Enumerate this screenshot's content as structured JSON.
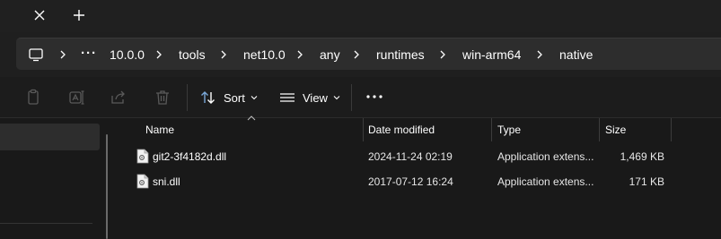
{
  "tabs": {
    "close_glyph": "✕",
    "new_glyph": "+"
  },
  "address": {
    "more_label": "···",
    "breadcrumbs": [
      "10.0.0",
      "tools",
      "net10.0",
      "any",
      "runtimes",
      "win-arm64",
      "native"
    ]
  },
  "toolbar": {
    "sort_label": "Sort",
    "view_label": "View",
    "icons": [
      "copy-icon",
      "rename-icon",
      "share-icon",
      "delete-icon",
      "sort-icon",
      "view-icon",
      "more-icon"
    ]
  },
  "columns": {
    "name": "Name",
    "date": "Date modified",
    "type": "Type",
    "size": "Size"
  },
  "files": [
    {
      "name": "git2-3f4182d.dll",
      "date": "2024-11-24 02:19",
      "type": "Application extens...",
      "size": "1,469 KB"
    },
    {
      "name": "sni.dll",
      "date": "2017-07-12 16:24",
      "type": "Application extens...",
      "size": "171 KB"
    }
  ],
  "colors": {
    "background": "#191919",
    "address_bar": "#2d2d2d",
    "selection": "#2d2d2d"
  }
}
